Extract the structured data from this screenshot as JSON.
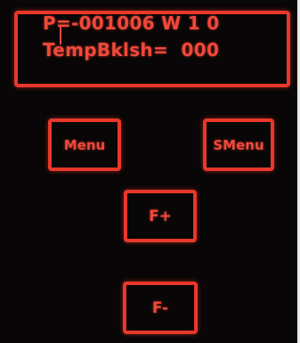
{
  "display": {
    "line1": "P=-001006 W 1 0",
    "line2": "TempBklsh=  000"
  },
  "buttons": {
    "menu": "Menu",
    "smenu": "SMenu",
    "f_plus": "F+",
    "f_minus": "F-"
  },
  "colors": {
    "accent": "#e8382b",
    "text": "#f0483a",
    "background": "#080606"
  }
}
